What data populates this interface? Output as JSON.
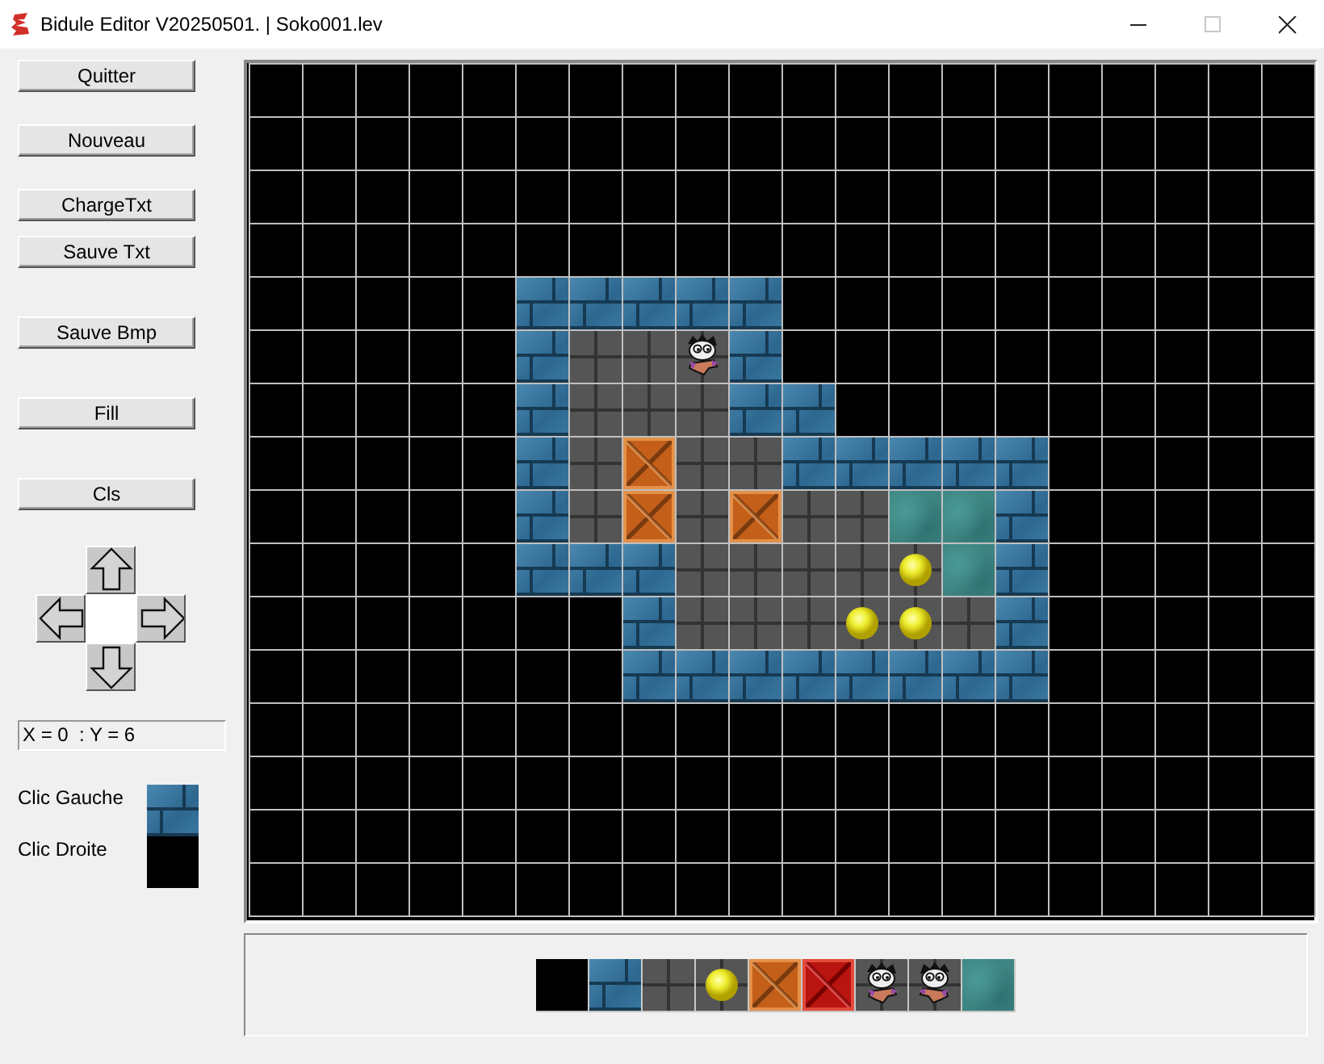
{
  "window": {
    "title": "Bidule Editor V20250501. | Soko001.lev",
    "controls": [
      {
        "kind": "minimize",
        "disabled": false
      },
      {
        "kind": "maximize",
        "disabled": true
      },
      {
        "kind": "close",
        "disabled": false
      }
    ]
  },
  "toolbar": {
    "buttons": [
      "Quitter",
      "Nouveau",
      "ChargeTxt",
      "Sauve Txt",
      "Sauve Bmp",
      "Fill",
      "Cls"
    ]
  },
  "arrow_pad": [
    {
      "kind": "up"
    },
    {
      "kind": "left"
    },
    {
      "kind": "right"
    },
    {
      "kind": "down"
    }
  ],
  "coordinates": "X = 0  : Y = 6",
  "brushes": [
    {
      "label": "Clic Gauche",
      "kind": "wall"
    },
    {
      "label": "Clic Droite",
      "kind": "empty"
    }
  ],
  "map": {
    "rows": [
      [
        {
          "kind": "empty"
        },
        {
          "kind": "empty"
        },
        {
          "kind": "empty"
        },
        {
          "kind": "empty"
        },
        {
          "kind": "empty"
        },
        {
          "kind": "empty"
        },
        {
          "kind": "empty"
        },
        {
          "kind": "empty"
        },
        {
          "kind": "empty"
        },
        {
          "kind": "empty"
        },
        {
          "kind": "empty"
        },
        {
          "kind": "empty"
        },
        {
          "kind": "empty"
        },
        {
          "kind": "empty"
        },
        {
          "kind": "empty"
        },
        {
          "kind": "empty"
        },
        {
          "kind": "empty"
        },
        {
          "kind": "empty"
        },
        {
          "kind": "empty"
        },
        {
          "kind": "empty"
        }
      ],
      [
        {
          "kind": "empty"
        },
        {
          "kind": "empty"
        },
        {
          "kind": "empty"
        },
        {
          "kind": "empty"
        },
        {
          "kind": "empty"
        },
        {
          "kind": "empty"
        },
        {
          "kind": "empty"
        },
        {
          "kind": "empty"
        },
        {
          "kind": "empty"
        },
        {
          "kind": "empty"
        },
        {
          "kind": "empty"
        },
        {
          "kind": "empty"
        },
        {
          "kind": "empty"
        },
        {
          "kind": "empty"
        },
        {
          "kind": "empty"
        },
        {
          "kind": "empty"
        },
        {
          "kind": "empty"
        },
        {
          "kind": "empty"
        },
        {
          "kind": "empty"
        },
        {
          "kind": "empty"
        }
      ],
      [
        {
          "kind": "empty"
        },
        {
          "kind": "empty"
        },
        {
          "kind": "empty"
        },
        {
          "kind": "empty"
        },
        {
          "kind": "empty"
        },
        {
          "kind": "empty"
        },
        {
          "kind": "empty"
        },
        {
          "kind": "empty"
        },
        {
          "kind": "empty"
        },
        {
          "kind": "empty"
        },
        {
          "kind": "empty"
        },
        {
          "kind": "empty"
        },
        {
          "kind": "empty"
        },
        {
          "kind": "empty"
        },
        {
          "kind": "empty"
        },
        {
          "kind": "empty"
        },
        {
          "kind": "empty"
        },
        {
          "kind": "empty"
        },
        {
          "kind": "empty"
        },
        {
          "kind": "empty"
        }
      ],
      [
        {
          "kind": "empty"
        },
        {
          "kind": "empty"
        },
        {
          "kind": "empty"
        },
        {
          "kind": "empty"
        },
        {
          "kind": "empty"
        },
        {
          "kind": "empty"
        },
        {
          "kind": "empty"
        },
        {
          "kind": "empty"
        },
        {
          "kind": "empty"
        },
        {
          "kind": "empty"
        },
        {
          "kind": "empty"
        },
        {
          "kind": "empty"
        },
        {
          "kind": "empty"
        },
        {
          "kind": "empty"
        },
        {
          "kind": "empty"
        },
        {
          "kind": "empty"
        },
        {
          "kind": "empty"
        },
        {
          "kind": "empty"
        },
        {
          "kind": "empty"
        },
        {
          "kind": "empty"
        }
      ],
      [
        {
          "kind": "empty"
        },
        {
          "kind": "empty"
        },
        {
          "kind": "empty"
        },
        {
          "kind": "empty"
        },
        {
          "kind": "empty"
        },
        {
          "kind": "wall"
        },
        {
          "kind": "wall"
        },
        {
          "kind": "wall"
        },
        {
          "kind": "wall"
        },
        {
          "kind": "wall"
        },
        {
          "kind": "empty"
        },
        {
          "kind": "empty"
        },
        {
          "kind": "empty"
        },
        {
          "kind": "empty"
        },
        {
          "kind": "empty"
        },
        {
          "kind": "empty"
        },
        {
          "kind": "empty"
        },
        {
          "kind": "empty"
        },
        {
          "kind": "empty"
        },
        {
          "kind": "empty"
        }
      ],
      [
        {
          "kind": "empty"
        },
        {
          "kind": "empty"
        },
        {
          "kind": "empty"
        },
        {
          "kind": "empty"
        },
        {
          "kind": "empty"
        },
        {
          "kind": "wall"
        },
        {
          "kind": "floor"
        },
        {
          "kind": "floor"
        },
        {
          "kind": "player"
        },
        {
          "kind": "wall"
        },
        {
          "kind": "empty"
        },
        {
          "kind": "empty"
        },
        {
          "kind": "empty"
        },
        {
          "kind": "empty"
        },
        {
          "kind": "empty"
        },
        {
          "kind": "empty"
        },
        {
          "kind": "empty"
        },
        {
          "kind": "empty"
        },
        {
          "kind": "empty"
        },
        {
          "kind": "empty"
        }
      ],
      [
        {
          "kind": "empty"
        },
        {
          "kind": "empty"
        },
        {
          "kind": "empty"
        },
        {
          "kind": "empty"
        },
        {
          "kind": "empty"
        },
        {
          "kind": "wall"
        },
        {
          "kind": "floor"
        },
        {
          "kind": "floor"
        },
        {
          "kind": "floor"
        },
        {
          "kind": "wall"
        },
        {
          "kind": "wall"
        },
        {
          "kind": "empty"
        },
        {
          "kind": "empty"
        },
        {
          "kind": "empty"
        },
        {
          "kind": "empty"
        },
        {
          "kind": "empty"
        },
        {
          "kind": "empty"
        },
        {
          "kind": "empty"
        },
        {
          "kind": "empty"
        },
        {
          "kind": "empty"
        }
      ],
      [
        {
          "kind": "empty"
        },
        {
          "kind": "empty"
        },
        {
          "kind": "empty"
        },
        {
          "kind": "empty"
        },
        {
          "kind": "empty"
        },
        {
          "kind": "wall"
        },
        {
          "kind": "floor"
        },
        {
          "kind": "crate"
        },
        {
          "kind": "floor"
        },
        {
          "kind": "floor"
        },
        {
          "kind": "wall"
        },
        {
          "kind": "wall"
        },
        {
          "kind": "wall"
        },
        {
          "kind": "wall"
        },
        {
          "kind": "wall"
        },
        {
          "kind": "empty"
        },
        {
          "kind": "empty"
        },
        {
          "kind": "empty"
        },
        {
          "kind": "empty"
        },
        {
          "kind": "empty"
        }
      ],
      [
        {
          "kind": "empty"
        },
        {
          "kind": "empty"
        },
        {
          "kind": "empty"
        },
        {
          "kind": "empty"
        },
        {
          "kind": "empty"
        },
        {
          "kind": "wall"
        },
        {
          "kind": "floor"
        },
        {
          "kind": "crate"
        },
        {
          "kind": "floor"
        },
        {
          "kind": "crate"
        },
        {
          "kind": "floor"
        },
        {
          "kind": "floor"
        },
        {
          "kind": "goal"
        },
        {
          "kind": "goal"
        },
        {
          "kind": "wall"
        },
        {
          "kind": "empty"
        },
        {
          "kind": "empty"
        },
        {
          "kind": "empty"
        },
        {
          "kind": "empty"
        },
        {
          "kind": "empty"
        }
      ],
      [
        {
          "kind": "empty"
        },
        {
          "kind": "empty"
        },
        {
          "kind": "empty"
        },
        {
          "kind": "empty"
        },
        {
          "kind": "empty"
        },
        {
          "kind": "wall"
        },
        {
          "kind": "wall"
        },
        {
          "kind": "wall"
        },
        {
          "kind": "floor"
        },
        {
          "kind": "floor"
        },
        {
          "kind": "floor"
        },
        {
          "kind": "floor"
        },
        {
          "kind": "ball"
        },
        {
          "kind": "goal"
        },
        {
          "kind": "wall"
        },
        {
          "kind": "empty"
        },
        {
          "kind": "empty"
        },
        {
          "kind": "empty"
        },
        {
          "kind": "empty"
        },
        {
          "kind": "empty"
        }
      ],
      [
        {
          "kind": "empty"
        },
        {
          "kind": "empty"
        },
        {
          "kind": "empty"
        },
        {
          "kind": "empty"
        },
        {
          "kind": "empty"
        },
        {
          "kind": "empty"
        },
        {
          "kind": "empty"
        },
        {
          "kind": "wall"
        },
        {
          "kind": "floor"
        },
        {
          "kind": "floor"
        },
        {
          "kind": "floor"
        },
        {
          "kind": "ball"
        },
        {
          "kind": "ball"
        },
        {
          "kind": "floor"
        },
        {
          "kind": "wall"
        },
        {
          "kind": "empty"
        },
        {
          "kind": "empty"
        },
        {
          "kind": "empty"
        },
        {
          "kind": "empty"
        },
        {
          "kind": "empty"
        }
      ],
      [
        {
          "kind": "empty"
        },
        {
          "kind": "empty"
        },
        {
          "kind": "empty"
        },
        {
          "kind": "empty"
        },
        {
          "kind": "empty"
        },
        {
          "kind": "empty"
        },
        {
          "kind": "empty"
        },
        {
          "kind": "wall"
        },
        {
          "kind": "wall"
        },
        {
          "kind": "wall"
        },
        {
          "kind": "wall"
        },
        {
          "kind": "wall"
        },
        {
          "kind": "wall"
        },
        {
          "kind": "wall"
        },
        {
          "kind": "wall"
        },
        {
          "kind": "empty"
        },
        {
          "kind": "empty"
        },
        {
          "kind": "empty"
        },
        {
          "kind": "empty"
        },
        {
          "kind": "empty"
        }
      ],
      [
        {
          "kind": "empty"
        },
        {
          "kind": "empty"
        },
        {
          "kind": "empty"
        },
        {
          "kind": "empty"
        },
        {
          "kind": "empty"
        },
        {
          "kind": "empty"
        },
        {
          "kind": "empty"
        },
        {
          "kind": "empty"
        },
        {
          "kind": "empty"
        },
        {
          "kind": "empty"
        },
        {
          "kind": "empty"
        },
        {
          "kind": "empty"
        },
        {
          "kind": "empty"
        },
        {
          "kind": "empty"
        },
        {
          "kind": "empty"
        },
        {
          "kind": "empty"
        },
        {
          "kind": "empty"
        },
        {
          "kind": "empty"
        },
        {
          "kind": "empty"
        },
        {
          "kind": "empty"
        }
      ],
      [
        {
          "kind": "empty"
        },
        {
          "kind": "empty"
        },
        {
          "kind": "empty"
        },
        {
          "kind": "empty"
        },
        {
          "kind": "empty"
        },
        {
          "kind": "empty"
        },
        {
          "kind": "empty"
        },
        {
          "kind": "empty"
        },
        {
          "kind": "empty"
        },
        {
          "kind": "empty"
        },
        {
          "kind": "empty"
        },
        {
          "kind": "empty"
        },
        {
          "kind": "empty"
        },
        {
          "kind": "empty"
        },
        {
          "kind": "empty"
        },
        {
          "kind": "empty"
        },
        {
          "kind": "empty"
        },
        {
          "kind": "empty"
        },
        {
          "kind": "empty"
        },
        {
          "kind": "empty"
        }
      ],
      [
        {
          "kind": "empty"
        },
        {
          "kind": "empty"
        },
        {
          "kind": "empty"
        },
        {
          "kind": "empty"
        },
        {
          "kind": "empty"
        },
        {
          "kind": "empty"
        },
        {
          "kind": "empty"
        },
        {
          "kind": "empty"
        },
        {
          "kind": "empty"
        },
        {
          "kind": "empty"
        },
        {
          "kind": "empty"
        },
        {
          "kind": "empty"
        },
        {
          "kind": "empty"
        },
        {
          "kind": "empty"
        },
        {
          "kind": "empty"
        },
        {
          "kind": "empty"
        },
        {
          "kind": "empty"
        },
        {
          "kind": "empty"
        },
        {
          "kind": "empty"
        },
        {
          "kind": "empty"
        }
      ],
      [
        {
          "kind": "empty"
        },
        {
          "kind": "empty"
        },
        {
          "kind": "empty"
        },
        {
          "kind": "empty"
        },
        {
          "kind": "empty"
        },
        {
          "kind": "empty"
        },
        {
          "kind": "empty"
        },
        {
          "kind": "empty"
        },
        {
          "kind": "empty"
        },
        {
          "kind": "empty"
        },
        {
          "kind": "empty"
        },
        {
          "kind": "empty"
        },
        {
          "kind": "empty"
        },
        {
          "kind": "empty"
        },
        {
          "kind": "empty"
        },
        {
          "kind": "empty"
        },
        {
          "kind": "empty"
        },
        {
          "kind": "empty"
        },
        {
          "kind": "empty"
        },
        {
          "kind": "empty"
        }
      ]
    ]
  },
  "palette": [
    {
      "kind": "empty"
    },
    {
      "kind": "wall"
    },
    {
      "kind": "floor"
    },
    {
      "kind": "ball"
    },
    {
      "kind": "crate"
    },
    {
      "kind": "goalcrate"
    },
    {
      "kind": "player"
    },
    {
      "kind": "playerleft"
    },
    {
      "kind": "goal"
    }
  ]
}
